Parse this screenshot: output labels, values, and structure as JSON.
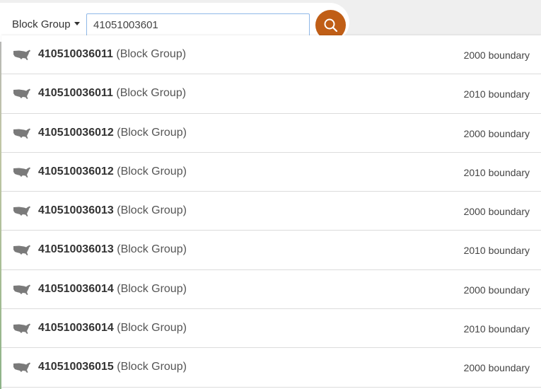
{
  "search": {
    "geography_type": "Block Group",
    "query": "41051003601",
    "button_icon": "search-icon",
    "accent_color": "#c05e16"
  },
  "results": [
    {
      "id": "410510036011",
      "type": "(Block Group)",
      "boundary": "2000 boundary",
      "icon": "us-map-icon"
    },
    {
      "id": "410510036011",
      "type": "(Block Group)",
      "boundary": "2010 boundary",
      "icon": "us-map-icon"
    },
    {
      "id": "410510036012",
      "type": "(Block Group)",
      "boundary": "2000 boundary",
      "icon": "us-map-icon"
    },
    {
      "id": "410510036012",
      "type": "(Block Group)",
      "boundary": "2010 boundary",
      "icon": "us-map-icon"
    },
    {
      "id": "410510036013",
      "type": "(Block Group)",
      "boundary": "2000 boundary",
      "icon": "us-map-icon"
    },
    {
      "id": "410510036013",
      "type": "(Block Group)",
      "boundary": "2010 boundary",
      "icon": "us-map-icon"
    },
    {
      "id": "410510036014",
      "type": "(Block Group)",
      "boundary": "2000 boundary",
      "icon": "us-map-icon"
    },
    {
      "id": "410510036014",
      "type": "(Block Group)",
      "boundary": "2010 boundary",
      "icon": "us-map-icon"
    },
    {
      "id": "410510036015",
      "type": "(Block Group)",
      "boundary": "2000 boundary",
      "icon": "us-map-icon"
    }
  ]
}
